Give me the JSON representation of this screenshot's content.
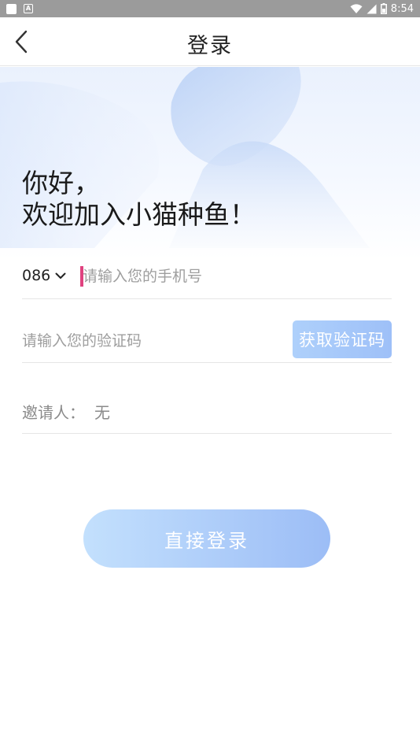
{
  "status_bar": {
    "time": "8:54",
    "left_icons": [
      "notification-square-icon",
      "app-a-icon"
    ],
    "right_icons": [
      "wifi-icon",
      "signal-icon",
      "battery-icon"
    ]
  },
  "header": {
    "title": "登录",
    "back_icon": "chevron-left-icon"
  },
  "greeting": {
    "line1": "你好，",
    "line2": "欢迎加入小猫种鱼！"
  },
  "phone": {
    "country_code": "086",
    "dropdown_icon": "chevron-down-icon",
    "placeholder": "请输入您的手机号",
    "value": ""
  },
  "verification": {
    "placeholder": "请输入您的验证码",
    "value": "",
    "get_code_label": "获取验证码"
  },
  "inviter": {
    "label": "邀请人：",
    "value": "无"
  },
  "actions": {
    "login_label": "直接登录"
  },
  "colors": {
    "status_bar": "#9b9b9b",
    "accent_light": "#c3e0fd",
    "accent": "#9cbdf6",
    "caret": "#e0427f",
    "placeholder": "#9e9e9e"
  }
}
